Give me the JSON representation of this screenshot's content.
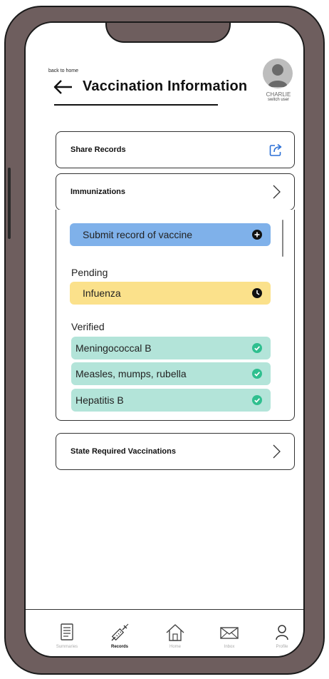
{
  "header": {
    "back_label": "back to home",
    "title": "Vaccination Information"
  },
  "user": {
    "name": "CHARLIE",
    "switch_label": "switch user"
  },
  "cards": {
    "share_label": "Share Records",
    "immunizations_label": "Immunizations",
    "state_label": "State Required Vaccinations"
  },
  "immunizations": {
    "submit_label": "Submit record of vaccine",
    "pending_heading": "Pending",
    "pending": [
      "Infuenza"
    ],
    "verified_heading": "Verified",
    "verified": [
      "Meningococcal B",
      "Measles, mumps, rubella",
      "Hepatitis B"
    ]
  },
  "nav": {
    "items": [
      {
        "label": "Summaries",
        "icon": "document-icon",
        "active": false
      },
      {
        "label": "Records",
        "icon": "syringe-icon",
        "active": true
      },
      {
        "label": "Home",
        "icon": "home-icon",
        "active": false
      },
      {
        "label": "Inbox",
        "icon": "mail-icon",
        "active": false
      },
      {
        "label": "Profile",
        "icon": "person-icon",
        "active": false
      }
    ]
  },
  "colors": {
    "phone_frame": "#6e5e5e",
    "submit_pill": "#7fb1ea",
    "pending_pill": "#fbe18b",
    "verified_pill": "#b3e4d9",
    "check_icon": "#2fbf8f",
    "share_icon": "#2a6fd6"
  }
}
